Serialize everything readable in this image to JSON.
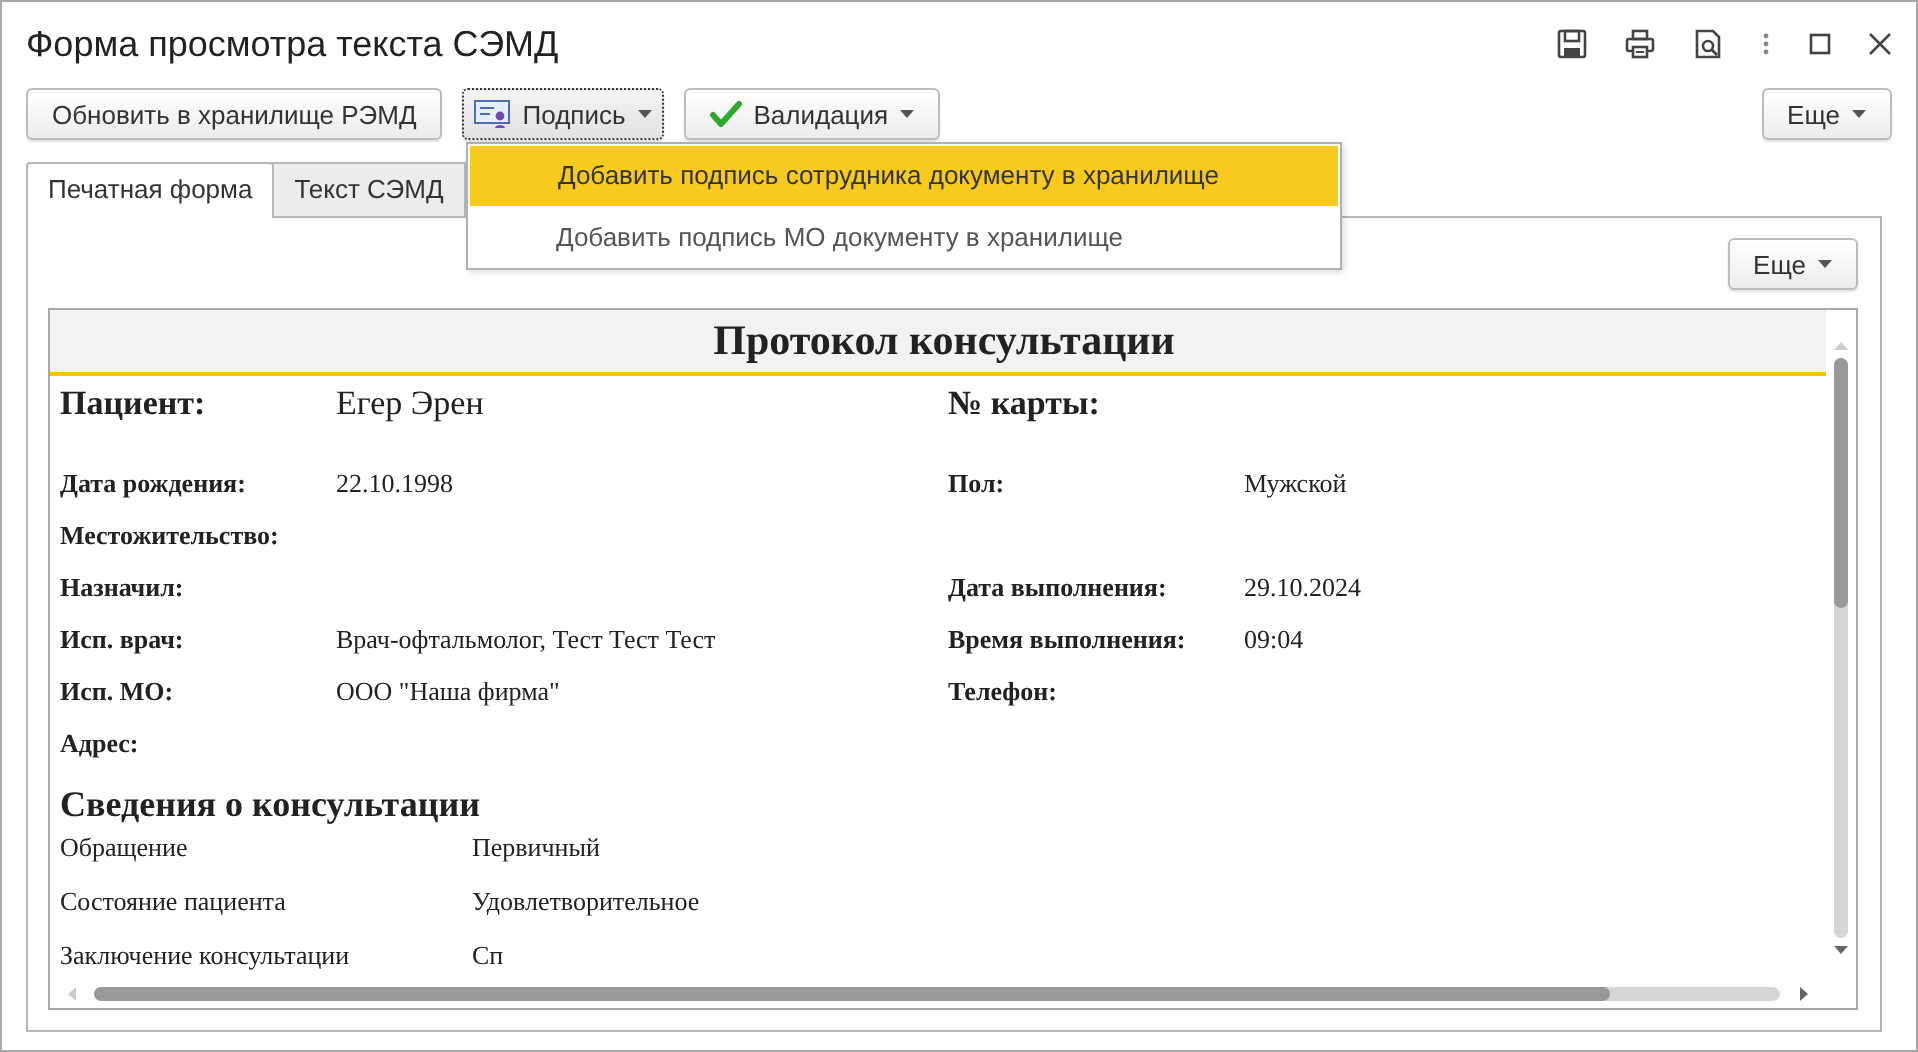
{
  "window": {
    "title": "Форма просмотра текста СЭМД"
  },
  "toolbar": {
    "buttons": [
      {
        "label": "Обновить в хранилище РЭМД",
        "kind": "plain",
        "expanded": false
      },
      {
        "label": "Подпись",
        "kind": "signature",
        "expanded": true
      },
      {
        "label": "Валидация",
        "kind": "validation",
        "expanded": false
      }
    ],
    "more_button": "Еще"
  },
  "menu": {
    "items": [
      {
        "label": "Добавить подпись сотрудника документу в хранилище",
        "selected": true
      },
      {
        "label": "Добавить подпись МО документу в хранилище",
        "selected": false
      }
    ]
  },
  "tabs": [
    {
      "label": "Печатная форма",
      "selected": true
    },
    {
      "label": "Текст СЭМД",
      "selected": false
    }
  ],
  "panel": {
    "more_button": "Еще"
  },
  "document": {
    "title": "Протокол консультации",
    "patient_label": "Пациент:",
    "patient_name": "Егер Эрен",
    "card_label": "№ карты:",
    "rows": [
      {
        "left": {
          "label": "Дата рождения:",
          "value": "22.10.1998"
        },
        "right": {
          "label": "Пол:",
          "value": "Мужской"
        }
      },
      {
        "left": {
          "label": "Местожительство:"
        }
      },
      {
        "left": {
          "label": "Назначил:"
        },
        "right": {
          "label": "Дата выполнения:",
          "value": "29.10.2024"
        }
      },
      {
        "left": {
          "label": "Исп. врач:",
          "value": "Врач-офтальмолог, Тест Тест Тест"
        },
        "right": {
          "label": "Время выполнения:",
          "value": "09:04"
        }
      },
      {
        "left": {
          "label": "Исп. МО:",
          "value": "ООО \"Наша фирма\""
        },
        "right": {
          "label": "Телефон:"
        }
      },
      {
        "left": {
          "label": "Адрес:"
        }
      }
    ],
    "section": {
      "heading": "Сведения о консультации",
      "items": [
        {
          "label": "Обращение",
          "value": "Первичный"
        },
        {
          "label": "Состояние пациента",
          "value": "Удовлетворительное"
        },
        {
          "label": "Заключение консультации",
          "value": "Сп"
        }
      ]
    }
  }
}
